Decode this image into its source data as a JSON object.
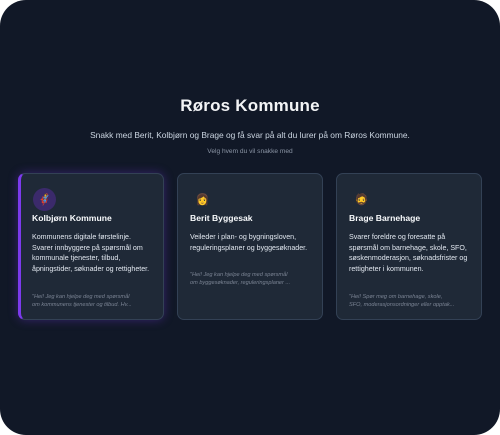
{
  "header": {
    "title": "Røros Kommune",
    "subtitle": "Snakk med Berit, Kolbjørn og Brage og få svar på alt du lurer på om Røros Kommune.",
    "hint": "Velg hvem du vil snakke med"
  },
  "assistants": [
    {
      "icon": "🦸",
      "icon_name": "superhero-icon",
      "name": "Kolbjørn Kommune",
      "description": "Kommunens digitale førstelinje. Svarer innbyggere på spørsmål om kommunale tjenester, tilbud, åpningstider, søknader og rettigheter.",
      "greeting_line1": "\"Hei! Jeg kan hjelpe deg med spørsmål",
      "greeting_line2": "om kommunens tjenester og tilbud. Hv...",
      "selected": true
    },
    {
      "icon": "👩",
      "icon_name": "woman-icon",
      "name": "Berit Byggesak",
      "description": "Veileder i plan- og bygningsloven, reguleringsplaner og byggesøknader.",
      "greeting_line1": "\"Hei! Jeg kan hjelpe deg med spørsmål",
      "greeting_line2": "om byggesøknader, reguleringsplaner ...",
      "selected": false
    },
    {
      "icon": "🧔",
      "icon_name": "bearded-man-icon",
      "name": "Brage Barnehage",
      "description": "Svarer foreldre og foresatte på spørsmål om barnehage, skole, SFO, søskenmoderasjon, søknadsfrister og rettigheter i kommunen.",
      "greeting_line1": "\"Hei! Spør meg om barnehage, skole,",
      "greeting_line2": "SFO, moderasjonsordninger eller opptak...",
      "selected": false
    }
  ]
}
